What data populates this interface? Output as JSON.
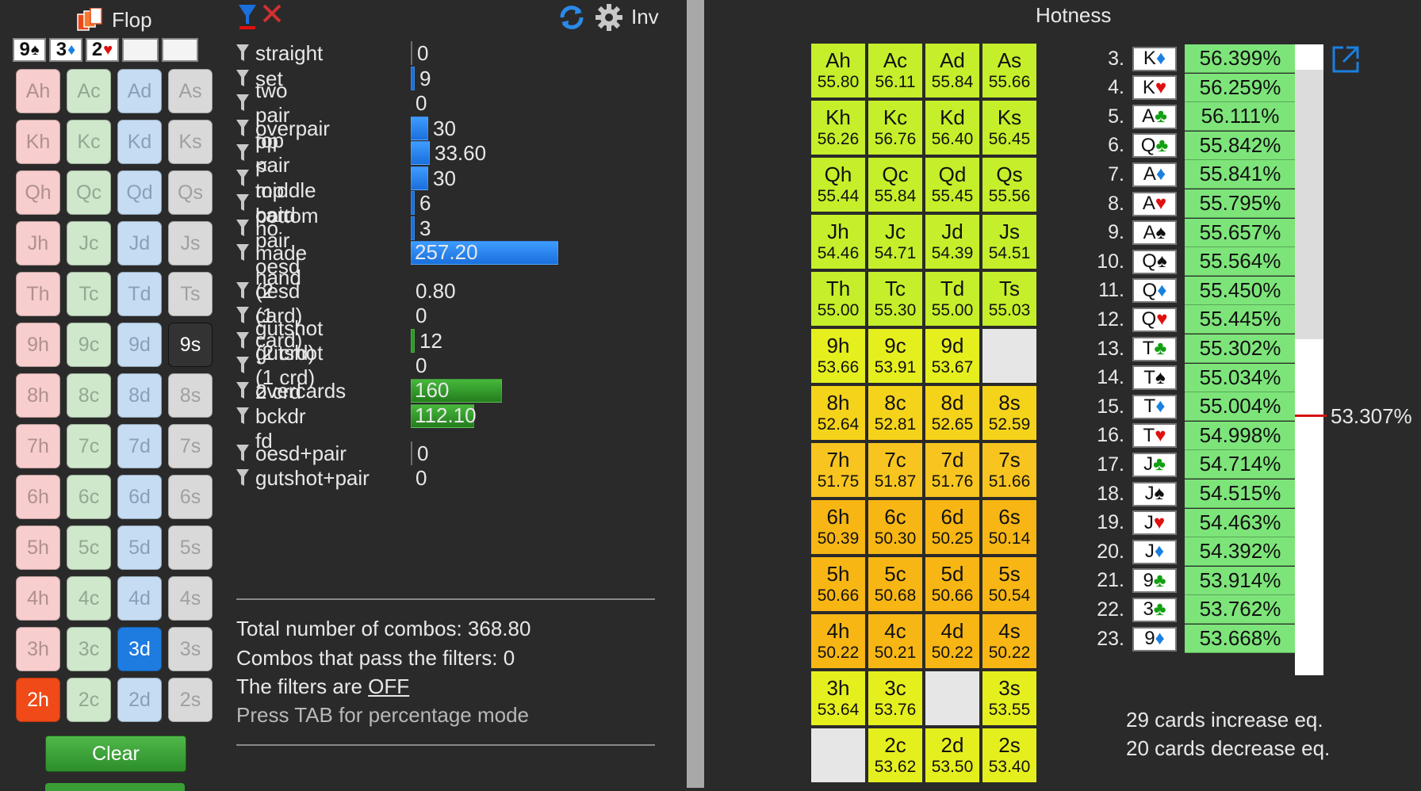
{
  "flop": {
    "title": "Flop",
    "slots": [
      {
        "rank": "9",
        "suit": "♠",
        "suit_color": "#111111"
      },
      {
        "rank": "3",
        "suit": "♦",
        "suit_color": "#1a80e0"
      },
      {
        "rank": "2",
        "suit": "♥",
        "suit_color": "#e01010"
      },
      {
        "rank": "",
        "suit": "",
        "suit_color": ""
      },
      {
        "rank": "",
        "suit": "",
        "suit_color": ""
      }
    ]
  },
  "card_grid": {
    "rows": [
      [
        "Ah",
        "Ac",
        "Ad",
        "As"
      ],
      [
        "Kh",
        "Kc",
        "Kd",
        "Ks"
      ],
      [
        "Qh",
        "Qc",
        "Qd",
        "Qs"
      ],
      [
        "Jh",
        "Jc",
        "Jd",
        "Js"
      ],
      [
        "Th",
        "Tc",
        "Td",
        "Ts"
      ],
      [
        "9h",
        "9c",
        "9d",
        "9s"
      ],
      [
        "8h",
        "8c",
        "8d",
        "8s"
      ],
      [
        "7h",
        "7c",
        "7d",
        "7s"
      ],
      [
        "6h",
        "6c",
        "6d",
        "6s"
      ],
      [
        "5h",
        "5c",
        "5d",
        "5s"
      ],
      [
        "4h",
        "4c",
        "4d",
        "4s"
      ],
      [
        "3h",
        "3c",
        "3d",
        "3s"
      ],
      [
        "2h",
        "2c",
        "2d",
        "2s"
      ]
    ],
    "selected": [
      "9s",
      "3d",
      "2h"
    ]
  },
  "clear_label": "Clear",
  "toolbar": {
    "inv_label": "Inv"
  },
  "filters": [
    {
      "label": "straight",
      "value": "0",
      "bar": "zero"
    },
    {
      "label": "set",
      "value": "9",
      "bar": "thin-blue"
    },
    {
      "label": "two pair",
      "value": "0",
      "bar": "none"
    },
    {
      "label": "overpair",
      "value": "30",
      "bar": "blue",
      "width": 22
    },
    {
      "label": "top pair",
      "value": "33.60",
      "bar": "blue",
      "width": 24
    },
    {
      "label": "pp < top card",
      "value": "30",
      "bar": "blue",
      "width": 22
    },
    {
      "label": "middle pair",
      "value": "6",
      "bar": "thin-blue"
    },
    {
      "label": "bottom pair",
      "value": "3",
      "bar": "thin-blue"
    },
    {
      "label": "no made hand",
      "value": "257.20",
      "bar": "blue-in",
      "width": 186
    },
    {
      "label": "oesd (2 card)",
      "value": "0.80",
      "bar": "none"
    },
    {
      "label": "oesd (1 card)",
      "value": "0",
      "bar": "none"
    },
    {
      "label": "gutshot (2 crd)",
      "value": "12",
      "bar": "thin-green"
    },
    {
      "label": "gutshot (1 crd)",
      "value": "0",
      "bar": "none"
    },
    {
      "label": "overcards",
      "value": "160",
      "bar": "green-in",
      "width": 115
    },
    {
      "label": "2 crd bckdr fd",
      "value": "112.10",
      "bar": "green-in",
      "width": 80
    },
    {
      "label": "oesd+pair",
      "value": "0",
      "bar": "zero"
    },
    {
      "label": "gutshot+pair",
      "value": "0",
      "bar": "none"
    }
  ],
  "summary": {
    "total": "Total number of combos: 368.80",
    "pass": "Combos that pass the filters: 0",
    "filters_prefix": "The filters are ",
    "filters_state": "OFF",
    "hint": "Press TAB for percentage mode"
  },
  "hotness": {
    "title": "Hotness",
    "grid": [
      [
        {
          "c": "Ah",
          "v": "55.80"
        },
        {
          "c": "Ac",
          "v": "56.11"
        },
        {
          "c": "Ad",
          "v": "55.84"
        },
        {
          "c": "As",
          "v": "55.66"
        }
      ],
      [
        {
          "c": "Kh",
          "v": "56.26"
        },
        {
          "c": "Kc",
          "v": "56.76"
        },
        {
          "c": "Kd",
          "v": "56.40"
        },
        {
          "c": "Ks",
          "v": "56.45"
        }
      ],
      [
        {
          "c": "Qh",
          "v": "55.44"
        },
        {
          "c": "Qc",
          "v": "55.84"
        },
        {
          "c": "Qd",
          "v": "55.45"
        },
        {
          "c": "Qs",
          "v": "55.56"
        }
      ],
      [
        {
          "c": "Jh",
          "v": "54.46"
        },
        {
          "c": "Jc",
          "v": "54.71"
        },
        {
          "c": "Jd",
          "v": "54.39"
        },
        {
          "c": "Js",
          "v": "54.51"
        }
      ],
      [
        {
          "c": "Th",
          "v": "55.00"
        },
        {
          "c": "Tc",
          "v": "55.30"
        },
        {
          "c": "Td",
          "v": "55.00"
        },
        {
          "c": "Ts",
          "v": "55.03"
        }
      ],
      [
        {
          "c": "9h",
          "v": "53.66"
        },
        {
          "c": "9c",
          "v": "53.91"
        },
        {
          "c": "9d",
          "v": "53.67"
        },
        {
          "c": "",
          "v": ""
        }
      ],
      [
        {
          "c": "8h",
          "v": "52.64"
        },
        {
          "c": "8c",
          "v": "52.81"
        },
        {
          "c": "8d",
          "v": "52.65"
        },
        {
          "c": "8s",
          "v": "52.59"
        }
      ],
      [
        {
          "c": "7h",
          "v": "51.75"
        },
        {
          "c": "7c",
          "v": "51.87"
        },
        {
          "c": "7d",
          "v": "51.76"
        },
        {
          "c": "7s",
          "v": "51.66"
        }
      ],
      [
        {
          "c": "6h",
          "v": "50.39"
        },
        {
          "c": "6c",
          "v": "50.30"
        },
        {
          "c": "6d",
          "v": "50.25"
        },
        {
          "c": "6s",
          "v": "50.14"
        }
      ],
      [
        {
          "c": "5h",
          "v": "50.66"
        },
        {
          "c": "5c",
          "v": "50.68"
        },
        {
          "c": "5d",
          "v": "50.66"
        },
        {
          "c": "5s",
          "v": "50.54"
        }
      ],
      [
        {
          "c": "4h",
          "v": "50.22"
        },
        {
          "c": "4c",
          "v": "50.21"
        },
        {
          "c": "4d",
          "v": "50.22"
        },
        {
          "c": "4s",
          "v": "50.22"
        }
      ],
      [
        {
          "c": "3h",
          "v": "53.64"
        },
        {
          "c": "3c",
          "v": "53.76"
        },
        {
          "c": "",
          "v": ""
        },
        {
          "c": "3s",
          "v": "53.55"
        }
      ],
      [
        {
          "c": "",
          "v": ""
        },
        {
          "c": "2c",
          "v": "53.62"
        },
        {
          "c": "2d",
          "v": "53.50"
        },
        {
          "c": "2s",
          "v": "53.40"
        }
      ]
    ],
    "ranking": [
      {
        "n": "3.",
        "r": "K",
        "s": "♦",
        "col": "blu",
        "p": "56.399%"
      },
      {
        "n": "4.",
        "r": "K",
        "s": "♥",
        "col": "red",
        "p": "56.259%"
      },
      {
        "n": "5.",
        "r": "A",
        "s": "♣",
        "col": "grn",
        "p": "56.111%"
      },
      {
        "n": "6.",
        "r": "Q",
        "s": "♣",
        "col": "grn",
        "p": "55.842%"
      },
      {
        "n": "7.",
        "r": "A",
        "s": "♦",
        "col": "blu",
        "p": "55.841%"
      },
      {
        "n": "8.",
        "r": "A",
        "s": "♥",
        "col": "red",
        "p": "55.795%"
      },
      {
        "n": "9.",
        "r": "A",
        "s": "♠",
        "col": "blk",
        "p": "55.657%"
      },
      {
        "n": "10.",
        "r": "Q",
        "s": "♠",
        "col": "blk",
        "p": "55.564%"
      },
      {
        "n": "11.",
        "r": "Q",
        "s": "♦",
        "col": "blu",
        "p": "55.450%"
      },
      {
        "n": "12.",
        "r": "Q",
        "s": "♥",
        "col": "red",
        "p": "55.445%"
      },
      {
        "n": "13.",
        "r": "T",
        "s": "♣",
        "col": "grn",
        "p": "55.302%"
      },
      {
        "n": "14.",
        "r": "T",
        "s": "♠",
        "col": "blk",
        "p": "55.034%"
      },
      {
        "n": "15.",
        "r": "T",
        "s": "♦",
        "col": "blu",
        "p": "55.004%"
      },
      {
        "n": "16.",
        "r": "T",
        "s": "♥",
        "col": "red",
        "p": "54.998%"
      },
      {
        "n": "17.",
        "r": "J",
        "s": "♣",
        "col": "grn",
        "p": "54.714%"
      },
      {
        "n": "18.",
        "r": "J",
        "s": "♠",
        "col": "blk",
        "p": "54.515%"
      },
      {
        "n": "19.",
        "r": "J",
        "s": "♥",
        "col": "red",
        "p": "54.463%"
      },
      {
        "n": "20.",
        "r": "J",
        "s": "♦",
        "col": "blu",
        "p": "54.392%"
      },
      {
        "n": "21.",
        "r": "9",
        "s": "♣",
        "col": "grn",
        "p": "53.914%"
      },
      {
        "n": "22.",
        "r": "3",
        "s": "♣",
        "col": "grn",
        "p": "53.762%"
      },
      {
        "n": "23.",
        "r": "9",
        "s": "♦",
        "col": "blu",
        "p": "53.668%"
      }
    ],
    "current_equity": "53.307%",
    "increase_text": "29 cards increase eq.",
    "decrease_text": "20 cards decrease eq."
  }
}
